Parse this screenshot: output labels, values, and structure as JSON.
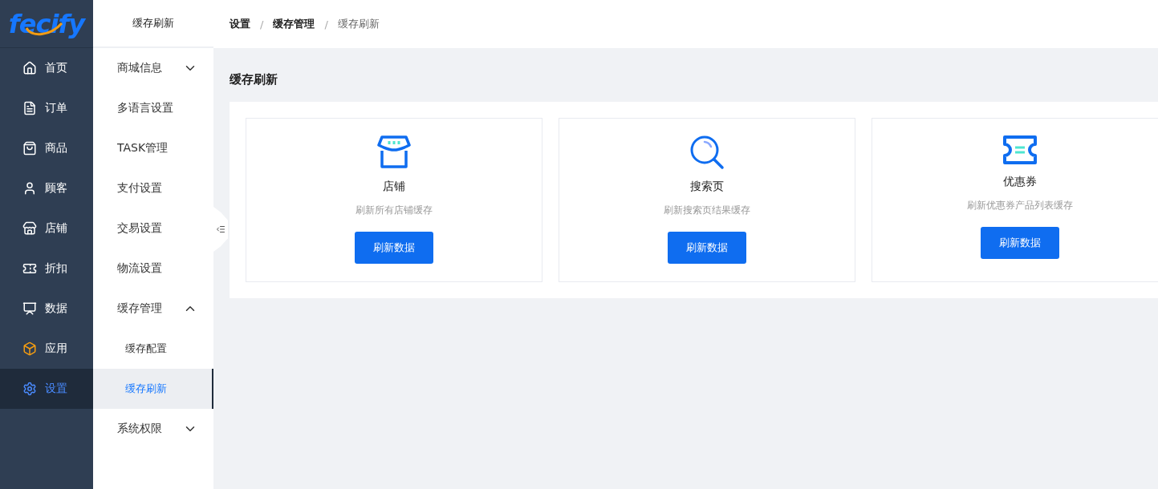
{
  "logo": {
    "text": "fecify"
  },
  "nav": [
    {
      "label": "首页",
      "selected": false
    },
    {
      "label": "订单",
      "selected": false
    },
    {
      "label": "商品",
      "selected": false
    },
    {
      "label": "顾客",
      "selected": false
    },
    {
      "label": "店铺",
      "selected": false
    },
    {
      "label": "折扣",
      "selected": false
    },
    {
      "label": "数据",
      "selected": false
    },
    {
      "label": "应用",
      "selected": false
    },
    {
      "label": "设置",
      "selected": true
    }
  ],
  "submenu": {
    "title": "缓存刷新",
    "items": [
      {
        "kind": "group",
        "label": "商城信息",
        "expanded": false
      },
      {
        "kind": "item",
        "label": "多语言设置",
        "selected": false
      },
      {
        "kind": "item",
        "label": "TASK管理",
        "selected": false
      },
      {
        "kind": "item",
        "label": "支付设置",
        "selected": false
      },
      {
        "kind": "item",
        "label": "交易设置",
        "selected": false
      },
      {
        "kind": "item",
        "label": "物流设置",
        "selected": false
      },
      {
        "kind": "group",
        "label": "缓存管理",
        "expanded": true,
        "children": [
          {
            "kind": "item",
            "label": "缓存配置",
            "selected": false
          },
          {
            "kind": "item",
            "label": "缓存刷新",
            "selected": true
          }
        ]
      },
      {
        "kind": "group",
        "label": "系统权限",
        "expanded": false
      }
    ]
  },
  "breadcrumb": {
    "separator": "/",
    "items": [
      {
        "label": "设置",
        "current": false
      },
      {
        "label": "缓存管理",
        "current": false
      },
      {
        "label": "缓存刷新",
        "current": true
      }
    ]
  },
  "page_title": "缓存刷新",
  "cards": [
    {
      "kind": "store",
      "title": "店铺",
      "description": "刷新所有店铺缓存",
      "button": "刷新数据"
    },
    {
      "kind": "search",
      "title": "搜索页",
      "description": "刷新搜索页结果缓存",
      "button": "刷新数据"
    },
    {
      "kind": "coupon",
      "title": "优惠券",
      "description": "刷新优惠券产品列表缓存",
      "button": "刷新数据"
    }
  ]
}
